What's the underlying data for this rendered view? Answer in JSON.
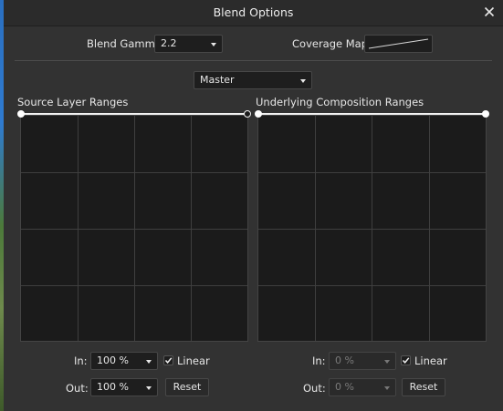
{
  "window": {
    "title": "Blend Options"
  },
  "header": {
    "blend_gamma_label": "Blend Gamma:",
    "blend_gamma_value": "2.2",
    "coverage_map_label": "Coverage Map:"
  },
  "channel": {
    "selected": "Master"
  },
  "source": {
    "title": "Source Layer Ranges",
    "in_label": "In:",
    "in_value": "100 %",
    "out_label": "Out:",
    "out_value": "100 %",
    "linear_label": "Linear",
    "linear_checked": true,
    "reset_label": "Reset"
  },
  "underlying": {
    "title": "Underlying Composition Ranges",
    "in_label": "In:",
    "in_value": "0 %",
    "out_label": "Out:",
    "out_value": "0 %",
    "linear_label": "Linear",
    "linear_checked": true,
    "reset_label": "Reset"
  },
  "colors": {
    "dialog_bg": "#323232",
    "graph_bg": "#1b1b1b",
    "range_line": "#f2f2f2"
  }
}
